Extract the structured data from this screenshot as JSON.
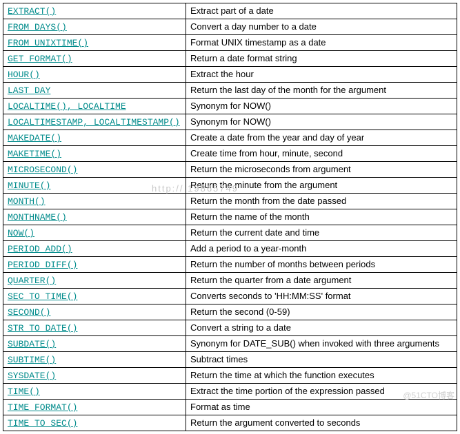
{
  "rows": [
    {
      "fn": "EXTRACT()",
      "desc": "Extract part of a date"
    },
    {
      "fn": "FROM_DAYS()",
      "desc": "Convert a day number to a date"
    },
    {
      "fn": "FROM_UNIXTIME()",
      "desc": "Format UNIX timestamp as a date"
    },
    {
      "fn": "GET_FORMAT()",
      "desc": "Return a date format string"
    },
    {
      "fn": "HOUR()",
      "desc": "Extract the hour"
    },
    {
      "fn": "LAST_DAY",
      "desc": "Return the last day of the month for the argument"
    },
    {
      "fn": "LOCALTIME(), LOCALTIME",
      "desc": "Synonym for NOW()"
    },
    {
      "fn": "LOCALTIMESTAMP, LOCALTIMESTAMP()",
      "desc": "Synonym for NOW()"
    },
    {
      "fn": "MAKEDATE()",
      "desc": "Create a date from the year and day of year"
    },
    {
      "fn": "MAKETIME()",
      "desc": "Create time from hour, minute, second"
    },
    {
      "fn": "MICROSECOND()",
      "desc": "Return the microseconds from argument"
    },
    {
      "fn": "MINUTE()",
      "desc": "Return the minute from the argument"
    },
    {
      "fn": "MONTH()",
      "desc": "Return the month from the date passed"
    },
    {
      "fn": "MONTHNAME()",
      "desc": "Return the name of the month"
    },
    {
      "fn": "NOW()",
      "desc": "Return the current date and time"
    },
    {
      "fn": "PERIOD_ADD()",
      "desc": "Add a period to a year-month"
    },
    {
      "fn": "PERIOD_DIFF()",
      "desc": "Return the number of months between periods"
    },
    {
      "fn": "QUARTER()",
      "desc": "Return the quarter from a date argument"
    },
    {
      "fn": "SEC_TO_TIME()",
      "desc": "Converts seconds to 'HH:MM:SS' format"
    },
    {
      "fn": "SECOND()",
      "desc": "Return the second (0-59)"
    },
    {
      "fn": "STR_TO_DATE()",
      "desc": "Convert a string to a date"
    },
    {
      "fn": "SUBDATE()",
      "desc": "Synonym for DATE_SUB() when invoked with three arguments"
    },
    {
      "fn": "SUBTIME()",
      "desc": "Subtract times"
    },
    {
      "fn": "SYSDATE()",
      "desc": "Return the time at which the function executes"
    },
    {
      "fn": "TIME()",
      "desc": "Extract the time portion of the expression passed"
    },
    {
      "fn": "TIME_FORMAT()",
      "desc": "Format as time"
    },
    {
      "fn": "TIME_TO_SEC()",
      "desc": "Return the argument converted to seconds"
    }
  ],
  "watermark_url": "http://     19865749",
  "watermark_corner": "@51CTO博客"
}
